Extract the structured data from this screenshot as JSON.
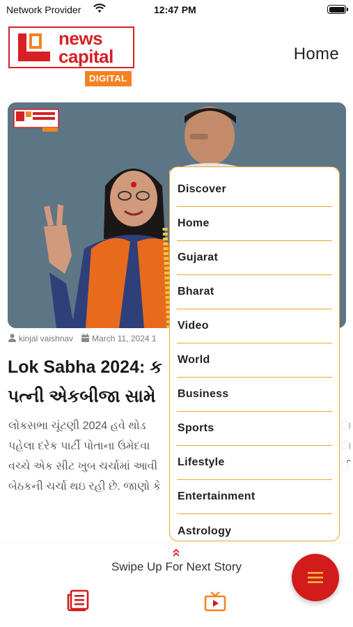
{
  "status_bar": {
    "carrier": "Network Provider",
    "time": "12:47 PM"
  },
  "header": {
    "logo": {
      "line1": "news",
      "line2": "capital",
      "tag": "DIGITAL"
    },
    "title": "Home"
  },
  "article": {
    "author": "kinjal vaishnav",
    "date": "March 11, 2024 1",
    "headline_line1": "Lok Sabha 2024: ક",
    "headline_line2": "પત્ની એકબીજા સામે",
    "summary_lines": [
      "લોકસભા ચૂંટણી 2024 હવે થોડ",
      "પહેલા દરેક પાર્ટી પોતાના ઉમેદવા",
      "વચ્ચે એક સીટ ખુબ ચર્ચામાં આવી",
      "બેઠકની ચર્ચા થઇ રહી છે. જાણો કે"
    ],
    "summary_right_edge": [
      "ા",
      "ા",
      "ી",
      ""
    ]
  },
  "menu": {
    "items": [
      "Discover",
      "Home",
      "Gujarat",
      "Bharat",
      "Video",
      "World",
      "Business",
      "Sports",
      "Lifestyle",
      "Entertainment",
      "Astrology"
    ]
  },
  "bottom_bar": {
    "swipe_text": "Swipe Up For Next Story",
    "icons": [
      "news-feed-icon",
      "tv-icon",
      "menu-icon"
    ]
  },
  "colors": {
    "brand_red": "#d71f26",
    "brand_orange": "#f58220",
    "menu_border": "#f0a429",
    "fab": "#d21b1b"
  }
}
